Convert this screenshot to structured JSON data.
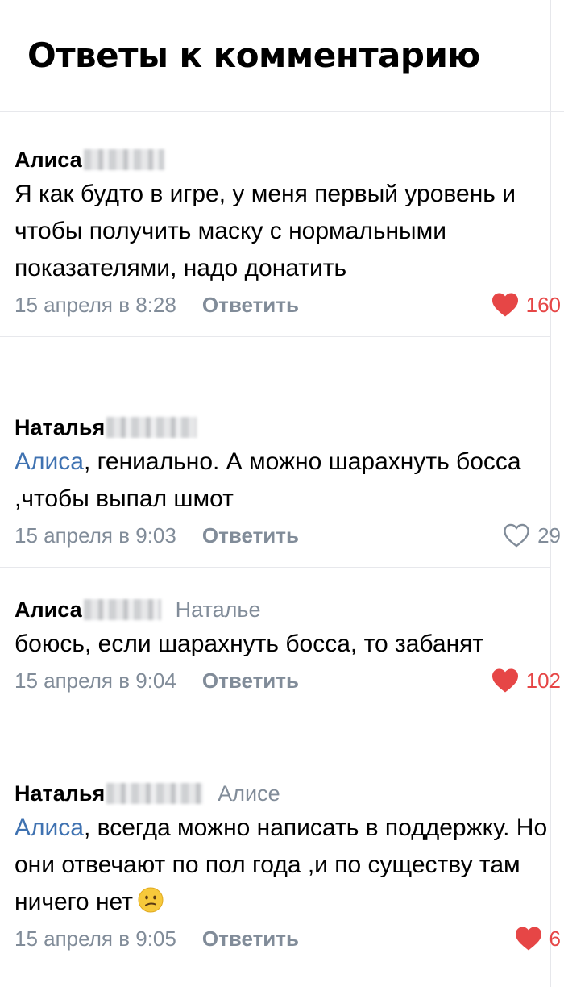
{
  "header": {
    "title": "Ответы к комментарию"
  },
  "colors": {
    "link": "#3f72b1",
    "meta": "#818c99",
    "like_active": "#e64646"
  },
  "comments": [
    {
      "author": "Алиса",
      "reply_to": "",
      "mention": "",
      "text": "Я как будто в игре, у меня первый уровень и чтобы получить маску с нормальными показателями, надо донатить",
      "date": "15 апреля в 8:28",
      "reply_label": "Ответить",
      "likes": "160",
      "liked": true
    },
    {
      "author": "Наталья",
      "reply_to": "",
      "mention": "Алиса",
      "text": ", гениально. А можно шарахнуть босса ,чтобы выпал шмот",
      "date": "15 апреля в 9:03",
      "reply_label": "Ответить",
      "likes": "29",
      "liked": false
    },
    {
      "author": "Алиса",
      "reply_to": "Наталье",
      "mention": "",
      "text": "боюсь, если шарахнуть босса, то забанят",
      "date": "15 апреля в 9:04",
      "reply_label": "Ответить",
      "likes": "102",
      "liked": true
    },
    {
      "author": "Наталья",
      "reply_to": "Алисе",
      "mention": "Алиса",
      "text": ", всегда можно написать в поддержку. Но они отвечают по пол года ,и по существу там ничего нет",
      "emoji": "confused-face-icon",
      "date": "15 апреля в 9:05",
      "reply_label": "Ответить",
      "likes": "6",
      "liked": true
    }
  ]
}
